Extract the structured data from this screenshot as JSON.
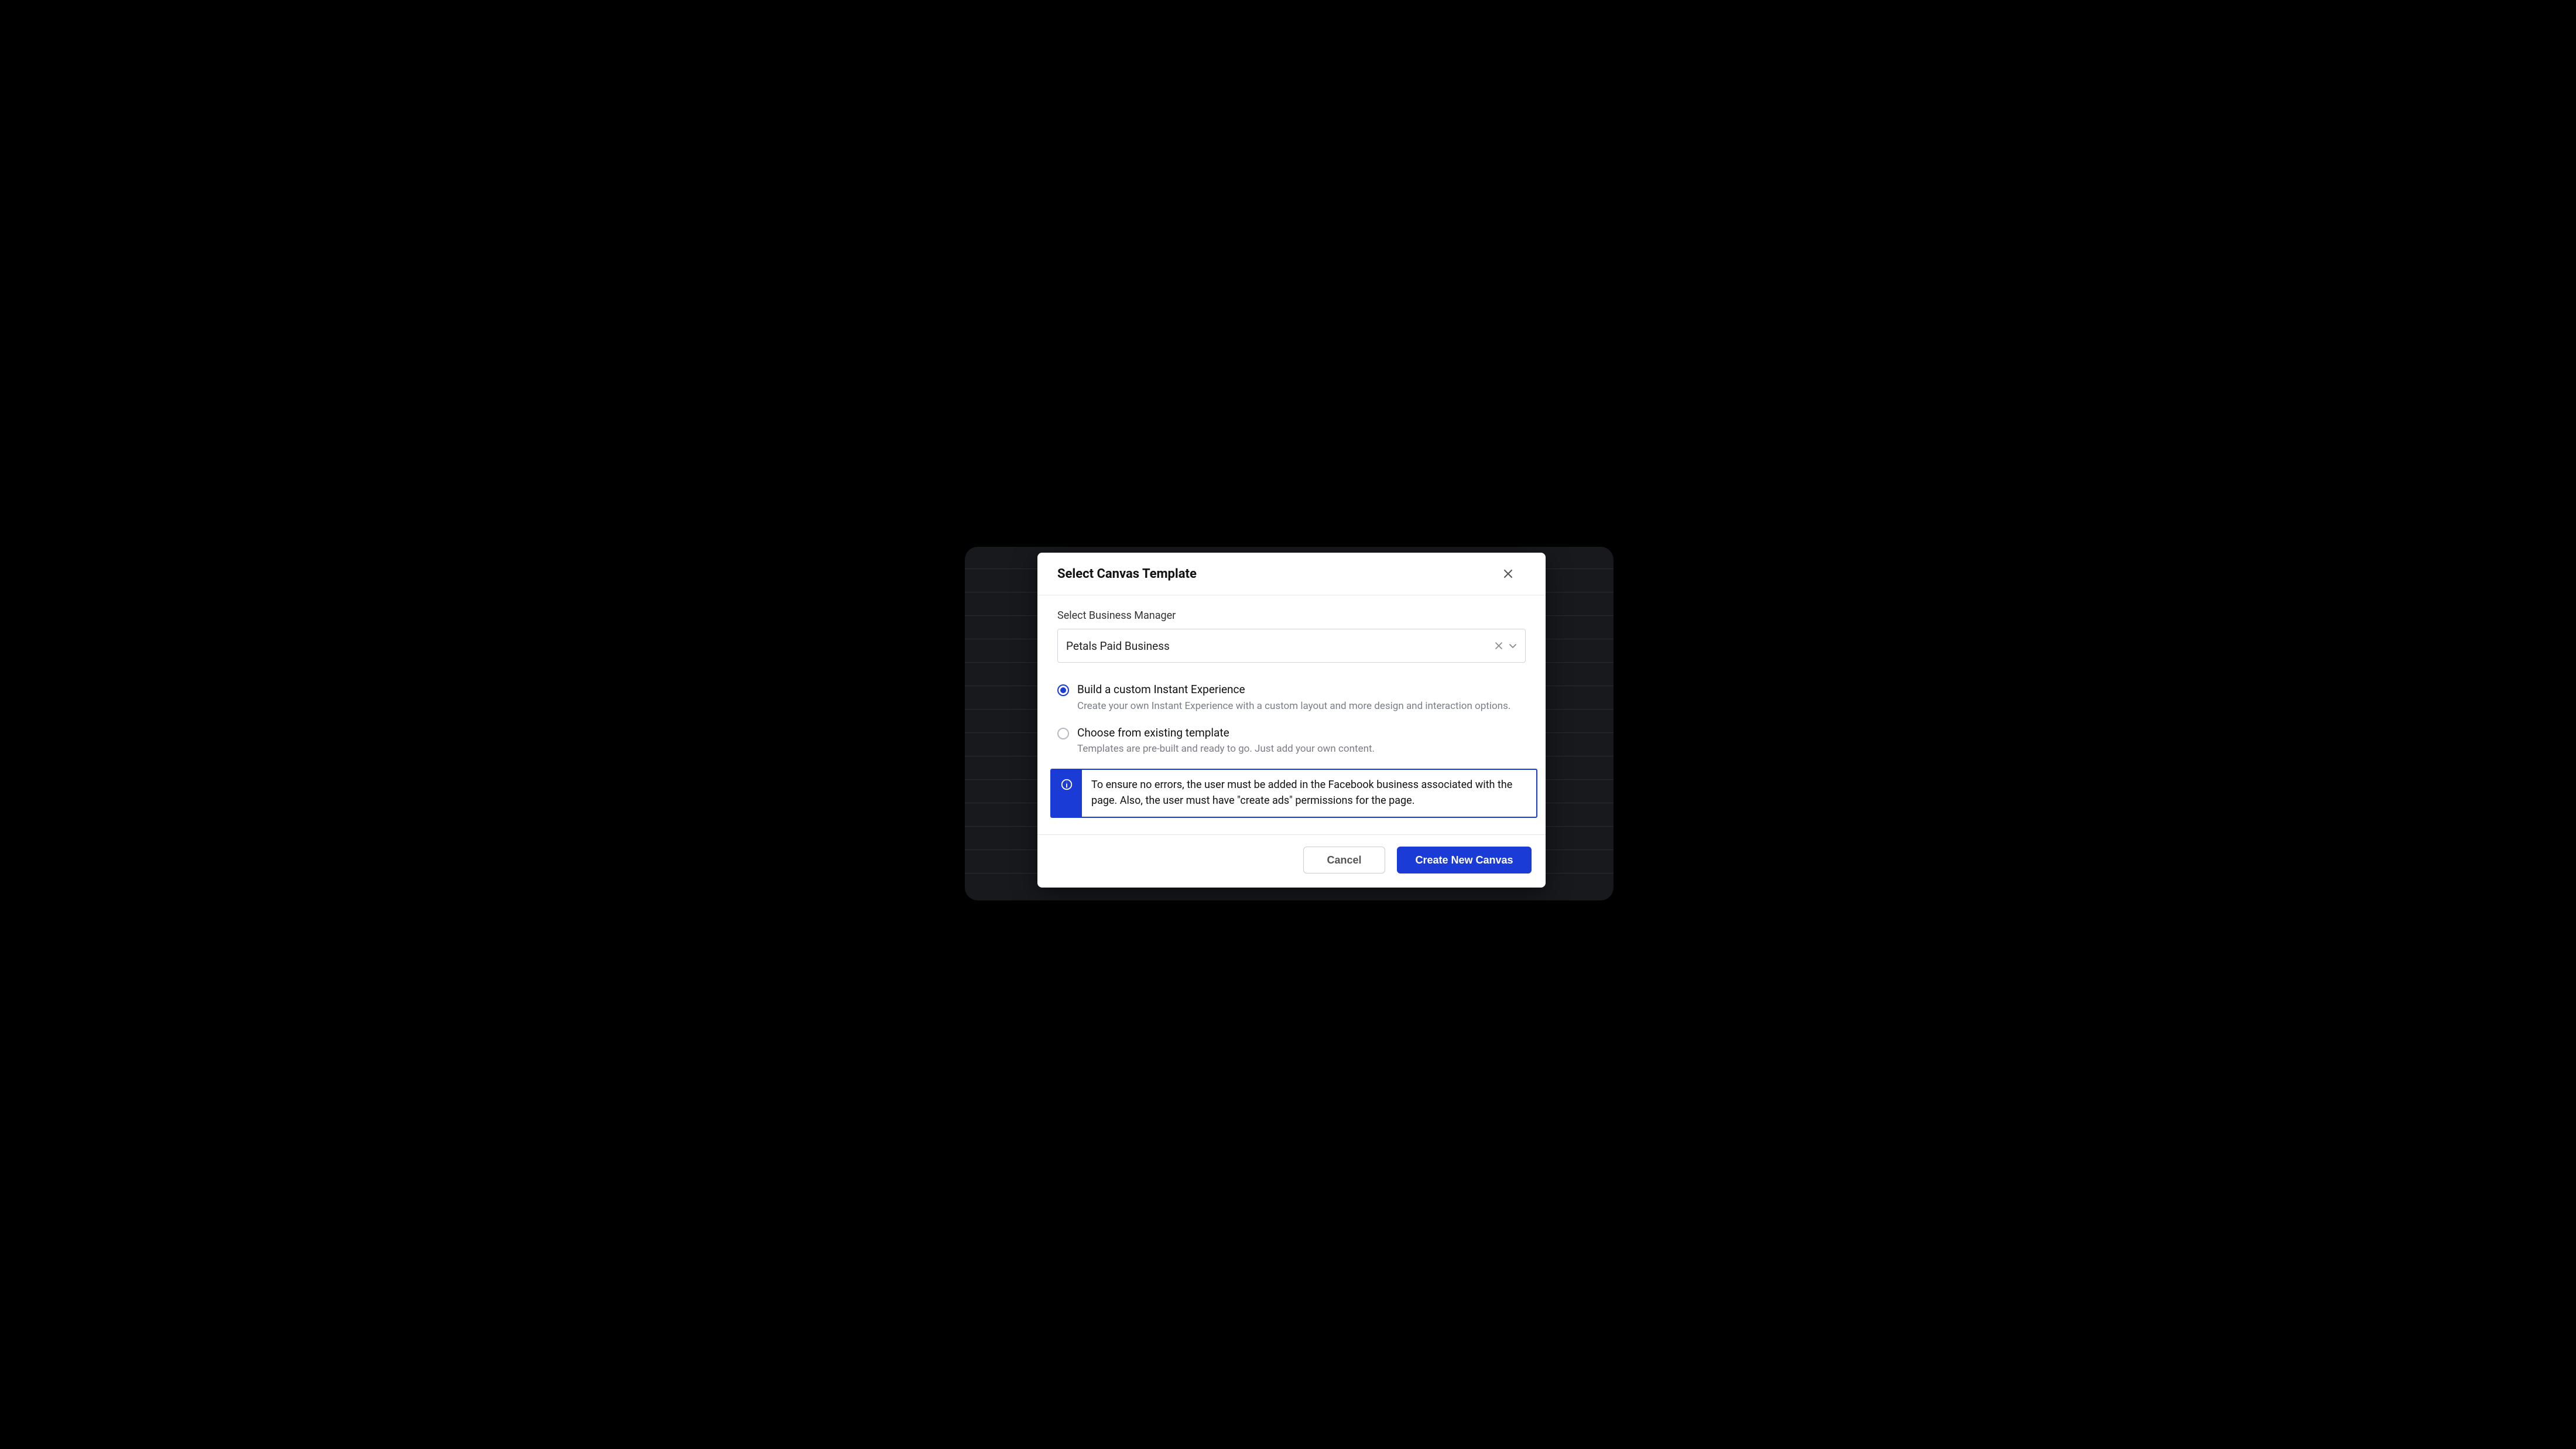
{
  "modal": {
    "title": "Select Canvas Template",
    "business_manager_label": "Select Business Manager",
    "business_manager_value": "Petals Paid Business",
    "radio_options": [
      {
        "label": "Build a custom Instant Experience",
        "description": "Create your own Instant Experience with a custom layout and more design and interaction options.",
        "selected": true
      },
      {
        "label": "Choose from existing template",
        "description": "Templates are pre-built and ready to go. Just add your own content.",
        "selected": false
      }
    ],
    "info_message": "To ensure no errors, the user must be added in the Facebook business associated with the page. Also, the user must have \"create ads\" permissions for the page.",
    "cancel_label": "Cancel",
    "submit_label": "Create New Canvas"
  },
  "colors": {
    "primary": "#1a3bd6",
    "text_muted": "#7a7d85",
    "border": "#d3d5da"
  }
}
